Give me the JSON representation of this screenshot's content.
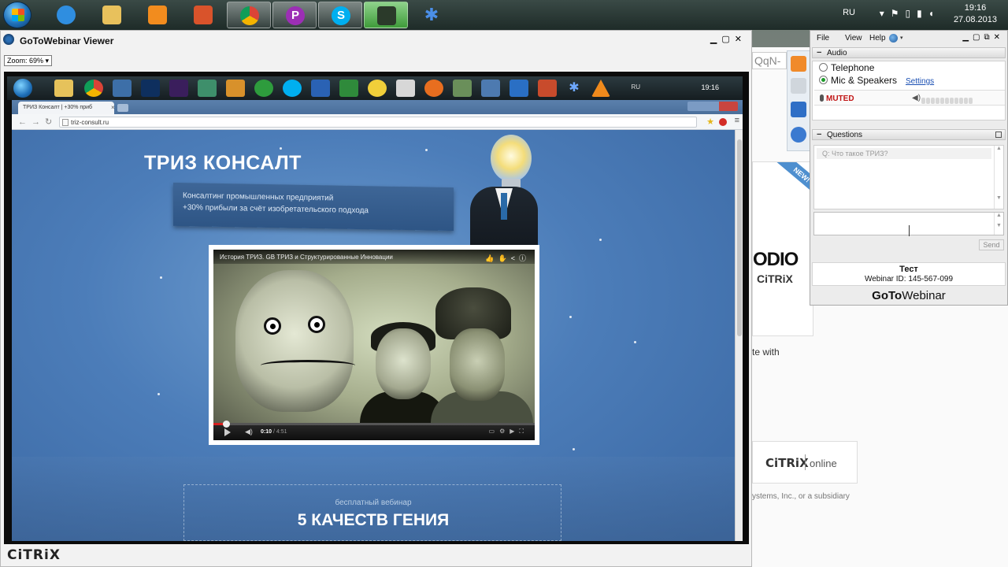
{
  "taskbar": {
    "language": "RU",
    "time": "19:16",
    "date": "27.08.2013",
    "apps": [
      {
        "name": "start-orb"
      },
      {
        "name": "internet-explorer-icon",
        "color": "#2f8ee0"
      },
      {
        "name": "file-explorer-icon",
        "color": "#e8c15c"
      },
      {
        "name": "media-player-icon",
        "color": "#f28c1e"
      },
      {
        "name": "office-icon",
        "color": "#d9532b"
      },
      {
        "name": "chrome-icon",
        "color": "#3aa757"
      },
      {
        "name": "p-app-icon",
        "color": "#9c2fb5"
      },
      {
        "name": "skype-icon",
        "color": "#00aff0"
      },
      {
        "name": "gotowebinar-share-icon",
        "color": "#4caf50"
      },
      {
        "name": "snowflake-app-icon",
        "color": "#3c7be0"
      }
    ]
  },
  "viewer": {
    "title": "GoToWebinar Viewer",
    "zoom_label": "Zoom: 69%",
    "footer_brand": "CiTRiX",
    "inner": {
      "taskbar_time": "19:16",
      "taskbar_lang": "RU",
      "tab_title": "ТРИЗ Консалт | +30% приб",
      "url": "triz-consult.ru",
      "site_title": "ТРИЗ КОНСАЛТ",
      "subtitle_line1": "Консалтинг промышленных предприятий",
      "subtitle_line2": "+30% прибыли за счёт изобретательского подхода",
      "video_title": "История ТРИЗ. GB ТРИЗ и Структурированные Инновации",
      "video_time": "0:10",
      "video_duration": "/ 4:51",
      "video_progress": 0.04,
      "free_webinar": "бесплатный вебинар",
      "headline": "5 КАЧЕСТВ ГЕНИЯ"
    }
  },
  "background_window": {
    "url_fragment": "QqN-",
    "new_badge": "NEW!",
    "brand_fragment": "ODIO",
    "citrix_small": "CiTRiX",
    "text_fragment": "te with",
    "citrix_word": "CiTRiX",
    "online_word": "online",
    "subsidiary_text": "ystems, Inc., or a subsidiary"
  },
  "panel": {
    "menu": [
      "File",
      "View",
      "Help"
    ],
    "audio": {
      "header": "Audio",
      "option_telephone": "Telephone",
      "option_mic": "Mic & Speakers",
      "settings_link": "Settings",
      "muted_label": "MUTED",
      "selected": "mic"
    },
    "questions": {
      "header": "Questions",
      "items": [
        "Q: Что такое ТРИЗ?"
      ],
      "send_label": "Send"
    },
    "webinar": {
      "title": "Тест",
      "id_text": "Webinar ID: 145-567-099"
    },
    "brand_goto": "GoTo",
    "brand_webinar": "Webinar"
  }
}
